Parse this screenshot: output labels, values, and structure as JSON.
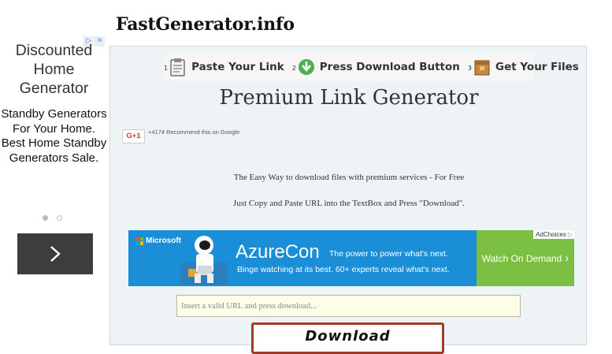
{
  "site": {
    "title": "FastGenerator.info"
  },
  "left_ad": {
    "headline": "Discounted Home Generator",
    "body": "Standby Generators For Your Home. Best Home Standby Generators Sale."
  },
  "steps": [
    {
      "num": "1",
      "label": "Paste Your Link",
      "icon": "clipboard-icon"
    },
    {
      "num": "2",
      "label": "Press Download Button",
      "icon": "download-arrow-icon"
    },
    {
      "num": "3",
      "label": "Get Your Files",
      "icon": "package-icon"
    }
  ],
  "main": {
    "heading": "Premium Link Generator",
    "gplus": {
      "button": "G+1",
      "text": "+4174 Recommend this on Google"
    },
    "description_1": "The Easy Way to download files with premium services - For Free",
    "description_2": "Just Copy and Paste URL into the TextBox and Press \"Download\"."
  },
  "azure_ad": {
    "brand": "Microsoft",
    "title": "AzureCon",
    "tagline": "The power to power what's next.",
    "subline": "Binge watching at its best. 60+ experts reveal what's next.",
    "cta": "Watch On Demand",
    "adchoices": "AdChoices"
  },
  "form": {
    "url_placeholder": "Insert a valid URL and press download...",
    "download_label": "Download"
  },
  "colors": {
    "panel_bg": "#eef3f6",
    "azure_blue": "#1a8fd8",
    "azure_green": "#7cc043",
    "button_border": "#a23a2b",
    "input_bg": "#fdfde8"
  }
}
